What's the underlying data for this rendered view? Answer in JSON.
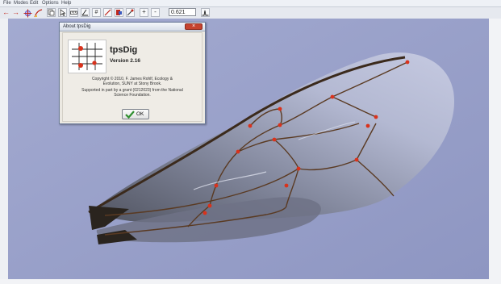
{
  "menu": {
    "items": [
      {
        "label": "File"
      },
      {
        "label": "Modes"
      },
      {
        "label": "Edit"
      },
      {
        "label": "Options"
      },
      {
        "label": "Help"
      }
    ]
  },
  "toolbar": {
    "buttons": [
      {
        "icon": "arrow-left-icon",
        "glyph": "←",
        "color": "#c0271c"
      },
      {
        "icon": "arrow-right-icon",
        "glyph": "→",
        "color": "#c0271c"
      },
      {
        "icon": "crosshair-icon",
        "glyph": "✜",
        "color": "#6a63c9"
      },
      {
        "icon": "pencil-curve-icon",
        "glyph": "⟋",
        "color": "#c0271c"
      },
      {
        "icon": "copy-icon",
        "glyph": "⧉",
        "color": "#333333"
      },
      {
        "icon": "pointer-icon",
        "glyph": "↖",
        "color": "#333333"
      },
      {
        "icon": "ruler-icon",
        "glyph": "▭",
        "color": "#333333"
      },
      {
        "icon": "angle-icon",
        "glyph": "∠",
        "color": "#333333"
      },
      {
        "icon": "hash-icon",
        "glyph": "#",
        "color": "#333333"
      },
      {
        "icon": "line-tool-icon",
        "glyph": "/",
        "color": "#c0271c"
      },
      {
        "icon": "flag-icon",
        "glyph": "⚑",
        "color": "#c0271c"
      },
      {
        "icon": "tool-icon",
        "glyph": "✎",
        "color": "#333333"
      }
    ],
    "zoom_in_label": "+",
    "zoom_out_label": "-",
    "zoom_value": "0.621",
    "signal_icon": "signal-icon"
  },
  "about": {
    "title": "About tpsDig",
    "close_label": "×",
    "app_name": "tpsDig",
    "version": "Version 2.16",
    "lines": [
      "Copyright © 2010, F. James Rohlf,  Ecology &",
      "Evolution, SUNY at Stony Brook.",
      "Supported in part by a grant (0212023) from the National",
      "Science Foundation."
    ],
    "ok_label": "OK"
  },
  "colors": {
    "viewport_bg": "#9aa2c9",
    "landmark": "#d9321c",
    "vein": "#5a3a22",
    "accent_check": "#2f8f2f"
  }
}
